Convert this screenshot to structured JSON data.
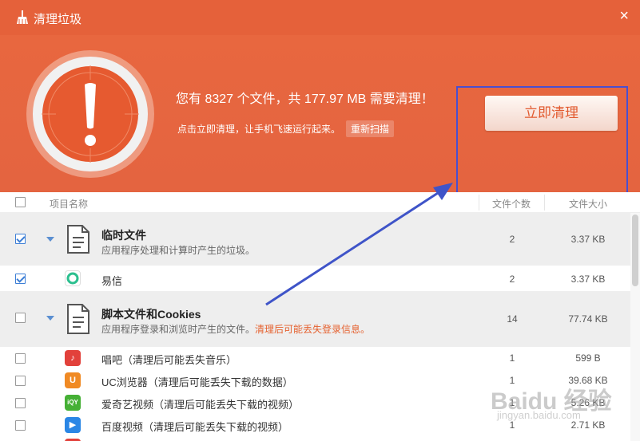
{
  "window": {
    "title": "清理垃圾",
    "close_icon": "close-icon",
    "close_glyph": "×"
  },
  "hero": {
    "message": "您有 8327 个文件，共 177.97 MB 需要清理！",
    "sub": "点击立即清理，让手机飞速运行起来。",
    "rescan_label": "重新扫描",
    "clean_label": "立即清理",
    "accent": "#e5613a"
  },
  "table": {
    "headers": {
      "name": "项目名称",
      "count": "文件个数",
      "size": "文件大小"
    },
    "rows": [
      {
        "checked": true,
        "group": true,
        "name": "临时文件",
        "desc": "应用程序处理和计算时产生的垃圾。",
        "warn": "",
        "count": "2",
        "size": "3.37 KB",
        "icon": "document-icon"
      },
      {
        "checked": true,
        "group": false,
        "name": "易信",
        "count": "2",
        "size": "3.37 KB",
        "icon": "yixin-app-icon",
        "icon_color": "#2cbf8f"
      },
      {
        "checked": false,
        "group": true,
        "name": "脚本文件和Cookies",
        "desc": "应用程序登录和浏览时产生的文件。",
        "warn": "清理后可能丢失登录信息。",
        "count": "14",
        "size": "77.74 KB",
        "icon": "script-document-icon"
      },
      {
        "checked": false,
        "group": false,
        "name": "唱吧（清理后可能丢失音乐）",
        "count": "1",
        "size": "599 B",
        "icon": "changba-app-icon",
        "icon_color": "#e2413b"
      },
      {
        "checked": false,
        "group": false,
        "name": "UC浏览器（清理后可能丢失下载的数据）",
        "count": "1",
        "size": "39.68 KB",
        "icon": "uc-browser-icon",
        "icon_color": "#f08a24"
      },
      {
        "checked": false,
        "group": false,
        "name": "爱奇艺视频（清理后可能丢失下载的视频）",
        "count": "1",
        "size": "5.26 KB",
        "icon": "iqiyi-app-icon",
        "icon_color": "#45b035"
      },
      {
        "checked": false,
        "group": false,
        "name": "百度视频（清理后可能丢失下载的视频）",
        "count": "1",
        "size": "2.71 KB",
        "icon": "baidu-video-icon",
        "icon_color": "#2a86e5"
      }
    ]
  },
  "watermark": {
    "text": "Baidu 经验",
    "sub": "jingyan.baidu.com"
  }
}
